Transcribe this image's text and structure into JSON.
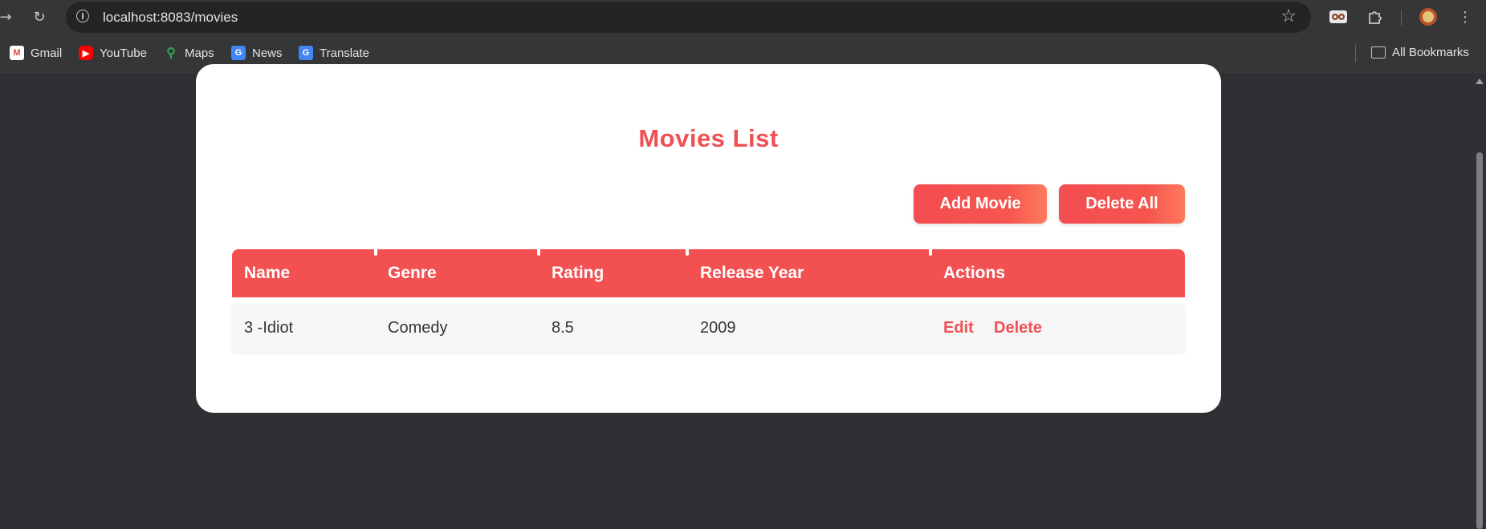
{
  "browser": {
    "url": "localhost:8083/movies",
    "bookmarks": [
      {
        "label": "Gmail",
        "icon": "gmail-icon",
        "color": "#ea4335"
      },
      {
        "label": "YouTube",
        "icon": "youtube-icon",
        "color": "#ff0000"
      },
      {
        "label": "Maps",
        "icon": "maps-icon",
        "color": "#34a853"
      },
      {
        "label": "News",
        "icon": "news-icon",
        "color": "#4285f4"
      },
      {
        "label": "Translate",
        "icon": "translate-icon",
        "color": "#4285f4"
      }
    ],
    "all_bookmarks_label": "All Bookmarks"
  },
  "page": {
    "title": "Movies List",
    "add_button": "Add Movie",
    "delete_all_button": "Delete All",
    "accent_color": "#f35052",
    "table": {
      "columns": [
        "Name",
        "Genre",
        "Rating",
        "Release Year",
        "Actions"
      ],
      "rows": [
        {
          "name": "3 -Idiot",
          "genre": "Comedy",
          "rating": "8.5",
          "year": "2009",
          "edit": "Edit",
          "delete": "Delete"
        }
      ]
    }
  }
}
